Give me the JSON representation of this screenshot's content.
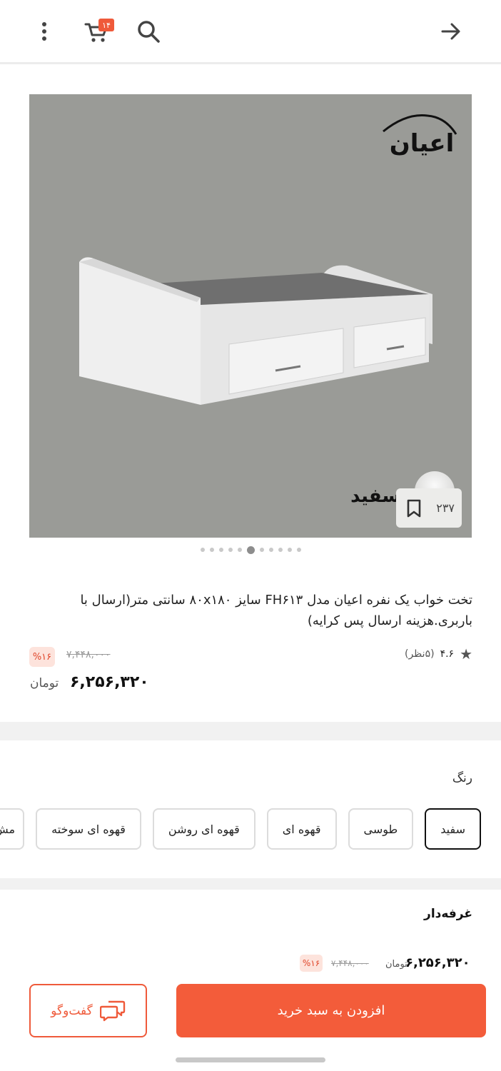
{
  "header": {
    "more_icon": "vertical-dots-icon",
    "cart_icon": "cart-icon",
    "cart_count": "۱۴",
    "search_icon": "search-icon",
    "back_icon": "arrow-right-icon"
  },
  "gallery": {
    "brand": "اعیان",
    "variant_label": "سفید",
    "bookmark_count": "۲۳۷",
    "dot_count": 11,
    "active_dot": 5
  },
  "product": {
    "title": "تخت خواب یک نفره اعیان مدل FH۶۱۳ سایز ۸۰x۱۸۰ سانتی متر(ارسال با باربری.هزینه ارسال پس کرایه)",
    "rating": "۴.۶",
    "reviews": "(۵نظر)",
    "old_price": "۷,۴۴۸,۰۰۰",
    "discount": "%۱۶",
    "price": "۶,۲۵۶,۳۲۰",
    "currency": "تومان"
  },
  "colors": {
    "title": "رنگ",
    "options": [
      "سفید",
      "طوسی",
      "قهوه ای",
      "قهوه ای روشن",
      "قهوه ای سوخته",
      "مش"
    ],
    "selected": "سفید"
  },
  "seller": {
    "title": "غرفه‌دار"
  },
  "bottom_bar": {
    "price": "۶,۲۵۶,۳۲۰",
    "currency": "تومان",
    "old_price": "۷,۴۴۸,۰۰۰",
    "discount": "%۱۶",
    "add_to_cart": "افزودن به سبد خرید",
    "chat": "گفت‌وگو"
  },
  "colors_theme": {
    "accent": "#f35c3a",
    "discount_bg": "#fde3dc",
    "image_bg": "#9a9b97"
  }
}
